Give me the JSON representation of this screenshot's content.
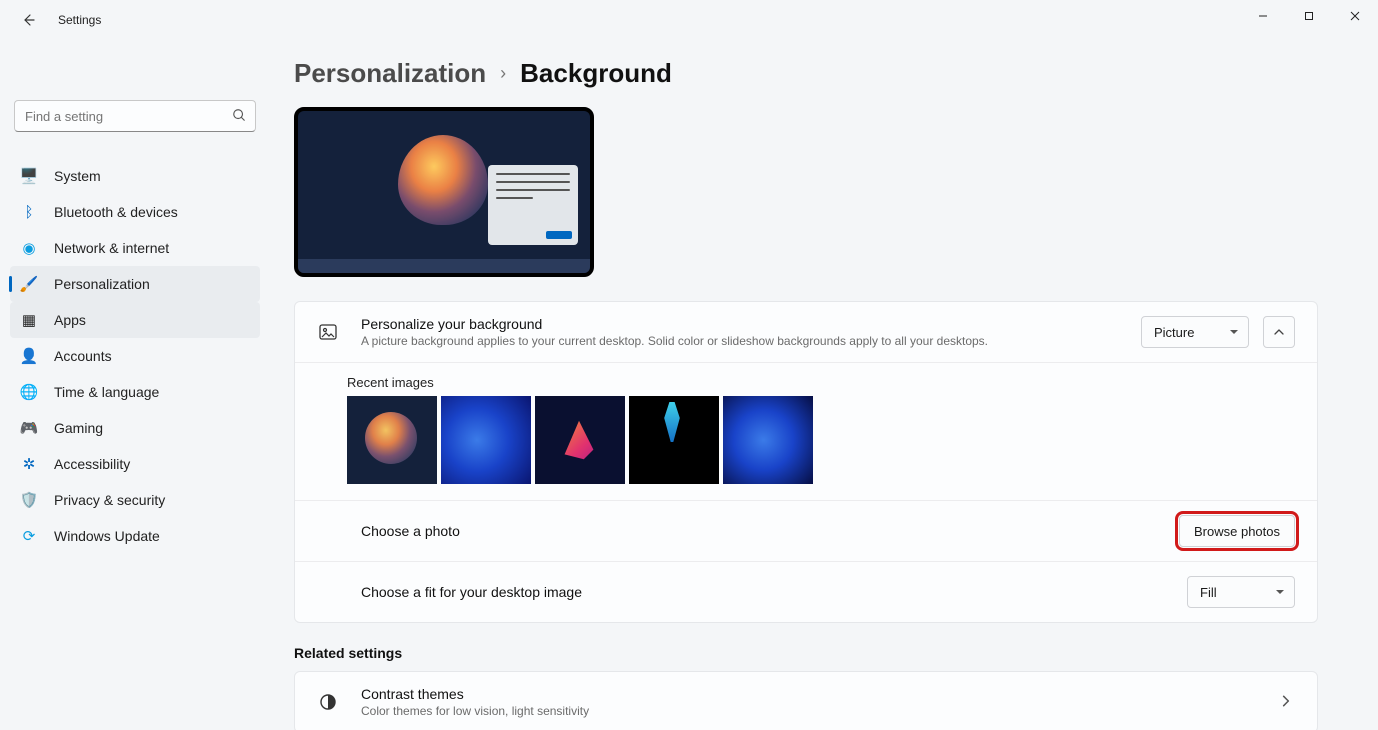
{
  "window": {
    "title": "Settings"
  },
  "search": {
    "placeholder": "Find a setting"
  },
  "sidebar": {
    "items": [
      {
        "label": "System"
      },
      {
        "label": "Bluetooth & devices"
      },
      {
        "label": "Network & internet"
      },
      {
        "label": "Personalization"
      },
      {
        "label": "Apps"
      },
      {
        "label": "Accounts"
      },
      {
        "label": "Time & language"
      },
      {
        "label": "Gaming"
      },
      {
        "label": "Accessibility"
      },
      {
        "label": "Privacy & security"
      },
      {
        "label": "Windows Update"
      }
    ]
  },
  "breadcrumb": {
    "parent": "Personalization",
    "current": "Background"
  },
  "background_panel": {
    "personalize": {
      "title": "Personalize your background",
      "subtitle": "A picture background applies to your current desktop. Solid color or slideshow backgrounds apply to all your desktops.",
      "dropdown_value": "Picture"
    },
    "recent_label": "Recent images",
    "choose_photo": {
      "label": "Choose a photo",
      "button": "Browse photos"
    },
    "choose_fit": {
      "label": "Choose a fit for your desktop image",
      "dropdown_value": "Fill"
    }
  },
  "related": {
    "heading": "Related settings",
    "contrast": {
      "title": "Contrast themes",
      "subtitle": "Color themes for low vision, light sensitivity"
    }
  }
}
